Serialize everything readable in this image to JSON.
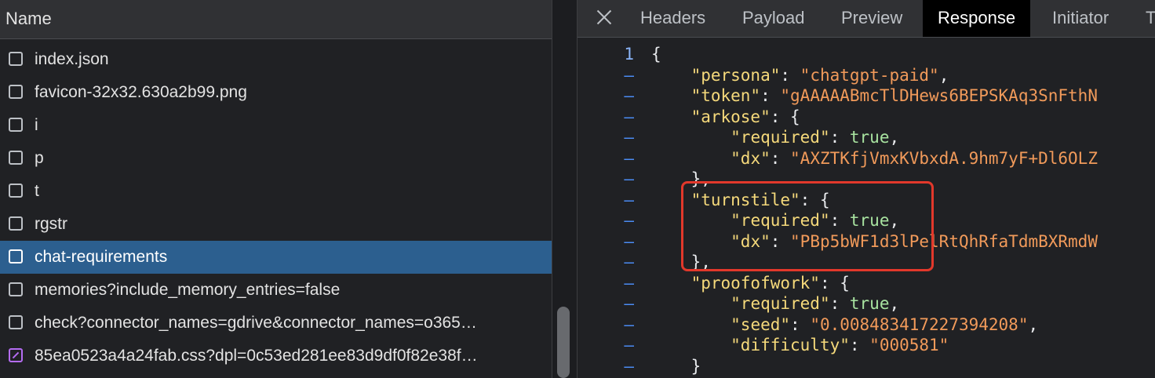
{
  "left_pane": {
    "header": "Name",
    "requests": [
      {
        "name": "index.json",
        "type": "doc",
        "selected": false
      },
      {
        "name": "favicon-32x32.630a2b99.png",
        "type": "doc",
        "selected": false
      },
      {
        "name": "i",
        "type": "doc",
        "selected": false
      },
      {
        "name": "p",
        "type": "doc",
        "selected": false
      },
      {
        "name": "t",
        "type": "doc",
        "selected": false
      },
      {
        "name": "rgstr",
        "type": "doc",
        "selected": false
      },
      {
        "name": "chat-requirements",
        "type": "doc",
        "selected": true
      },
      {
        "name": "memories?include_memory_entries=false",
        "type": "doc",
        "selected": false
      },
      {
        "name": "check?connector_names=gdrive&connector_names=o365…",
        "type": "doc",
        "selected": false
      },
      {
        "name": "85ea0523a4a24fab.css?dpl=0c53ed281ee83d9df0f82e38f…",
        "type": "css",
        "selected": false
      }
    ]
  },
  "right_pane": {
    "close_icon": "close-icon",
    "tabs": [
      "Headers",
      "Payload",
      "Preview",
      "Response",
      "Initiator",
      "T"
    ],
    "active_tab": "Response",
    "code_lines": [
      {
        "gutter": "1",
        "tokens": [
          {
            "c": "p",
            "t": "{"
          }
        ]
      },
      {
        "gutter": "–",
        "tokens": [
          {
            "c": "p",
            "t": "    "
          },
          {
            "c": "k",
            "t": "\"persona\""
          },
          {
            "c": "p",
            "t": ": "
          },
          {
            "c": "s",
            "t": "\"chatgpt-paid\""
          },
          {
            "c": "p",
            "t": ","
          }
        ]
      },
      {
        "gutter": "–",
        "tokens": [
          {
            "c": "p",
            "t": "    "
          },
          {
            "c": "k",
            "t": "\"token\""
          },
          {
            "c": "p",
            "t": ": "
          },
          {
            "c": "s",
            "t": "\"gAAAAABmcTlDHews6BEPSKAq3SnFthN"
          }
        ]
      },
      {
        "gutter": "–",
        "tokens": [
          {
            "c": "p",
            "t": "    "
          },
          {
            "c": "k",
            "t": "\"arkose\""
          },
          {
            "c": "p",
            "t": ": {"
          }
        ]
      },
      {
        "gutter": "–",
        "tokens": [
          {
            "c": "p",
            "t": "        "
          },
          {
            "c": "k",
            "t": "\"required\""
          },
          {
            "c": "p",
            "t": ": "
          },
          {
            "c": "b",
            "t": "true"
          },
          {
            "c": "p",
            "t": ","
          }
        ]
      },
      {
        "gutter": "–",
        "tokens": [
          {
            "c": "p",
            "t": "        "
          },
          {
            "c": "k",
            "t": "\"dx\""
          },
          {
            "c": "p",
            "t": ": "
          },
          {
            "c": "s",
            "t": "\"AXZTKfjVmxKVbxdA.9hm7yF+Dl6OLZ"
          }
        ]
      },
      {
        "gutter": "–",
        "tokens": [
          {
            "c": "p",
            "t": "    },"
          }
        ]
      },
      {
        "gutter": "–",
        "tokens": [
          {
            "c": "p",
            "t": "    "
          },
          {
            "c": "k",
            "t": "\"turnstile\""
          },
          {
            "c": "p",
            "t": ": {"
          }
        ]
      },
      {
        "gutter": "–",
        "tokens": [
          {
            "c": "p",
            "t": "        "
          },
          {
            "c": "k",
            "t": "\"required\""
          },
          {
            "c": "p",
            "t": ": "
          },
          {
            "c": "b",
            "t": "true"
          },
          {
            "c": "p",
            "t": ","
          }
        ]
      },
      {
        "gutter": "–",
        "tokens": [
          {
            "c": "p",
            "t": "        "
          },
          {
            "c": "k",
            "t": "\"dx\""
          },
          {
            "c": "p",
            "t": ": "
          },
          {
            "c": "s",
            "t": "\"PBp5bWF1d3lPelRtQhRfaTdmBXRmdW"
          }
        ]
      },
      {
        "gutter": "–",
        "tokens": [
          {
            "c": "p",
            "t": "    },"
          }
        ]
      },
      {
        "gutter": "–",
        "tokens": [
          {
            "c": "p",
            "t": "    "
          },
          {
            "c": "k",
            "t": "\"proofofwork\""
          },
          {
            "c": "p",
            "t": ": {"
          }
        ]
      },
      {
        "gutter": "–",
        "tokens": [
          {
            "c": "p",
            "t": "        "
          },
          {
            "c": "k",
            "t": "\"required\""
          },
          {
            "c": "p",
            "t": ": "
          },
          {
            "c": "b",
            "t": "true"
          },
          {
            "c": "p",
            "t": ","
          }
        ]
      },
      {
        "gutter": "–",
        "tokens": [
          {
            "c": "p",
            "t": "        "
          },
          {
            "c": "k",
            "t": "\"seed\""
          },
          {
            "c": "p",
            "t": ": "
          },
          {
            "c": "s",
            "t": "\"0.008483417227394208\""
          },
          {
            "c": "p",
            "t": ","
          }
        ]
      },
      {
        "gutter": "–",
        "tokens": [
          {
            "c": "p",
            "t": "        "
          },
          {
            "c": "k",
            "t": "\"difficulty\""
          },
          {
            "c": "p",
            "t": ": "
          },
          {
            "c": "s",
            "t": "\"000581\""
          }
        ]
      },
      {
        "gutter": "–",
        "tokens": [
          {
            "c": "p",
            "t": "    }"
          }
        ]
      }
    ]
  },
  "colors": {
    "selected_row": "#2c5f8f",
    "annotation_box": "#e2382b",
    "json_key": "#f5d97b",
    "json_string": "#f19a5a",
    "json_bool": "#a8e3a0"
  }
}
